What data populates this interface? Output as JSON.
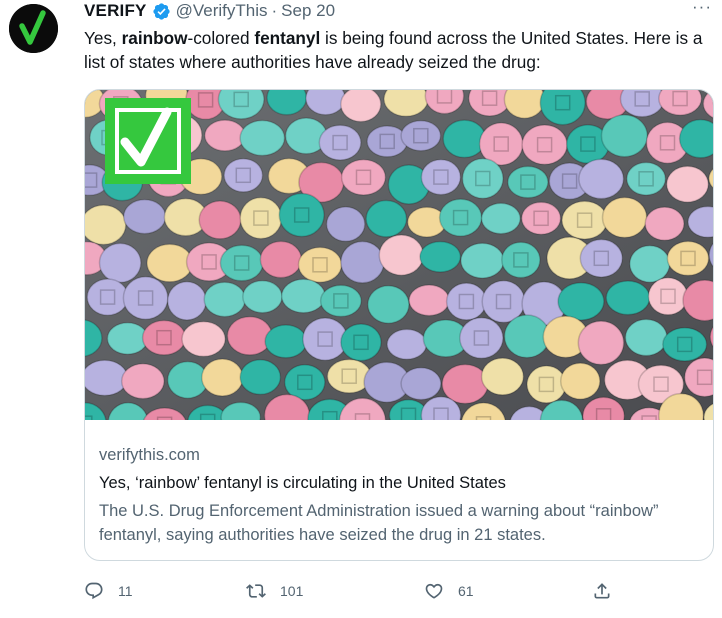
{
  "author": {
    "name": "VERIFY",
    "handle": "@VerifyThis",
    "separator": "·",
    "date": "Sep 20",
    "avatar_icon": "green-checkmark-logo",
    "verified_badge_icon": "verified-badge-icon"
  },
  "menu": {
    "more_label": "···"
  },
  "tweet": {
    "segments": [
      {
        "text": "Yes, ",
        "bold": false
      },
      {
        "text": "rainbow",
        "bold": true
      },
      {
        "text": "-colored ",
        "bold": false
      },
      {
        "text": "fentanyl",
        "bold": true
      },
      {
        "text": " is being found across the United States. Here is a list of states where authorities have already seized the drug:",
        "bold": false
      }
    ]
  },
  "card": {
    "image_description_icon": "pills-photo",
    "overlay_icon": "checkmark-box-icon",
    "domain": "verifythis.com",
    "title": "Yes, ‘rainbow’ fentanyl is circulating in the United States",
    "description": "The U.S. Drug Enforcement Administration issued a warning about “rainbow” fentanyl, saying authorities have seized the drug in 21 states."
  },
  "actions": {
    "reply": {
      "icon": "reply-icon",
      "count": "11"
    },
    "retweet": {
      "icon": "retweet-icon",
      "count": "101"
    },
    "like": {
      "icon": "heart-icon",
      "count": "61"
    },
    "share": {
      "icon": "share-icon"
    }
  },
  "colors": {
    "accent_blue": "#1d9bf0",
    "verify_green": "#35c83e",
    "muted_text": "#536471",
    "border": "#cfd9de"
  }
}
